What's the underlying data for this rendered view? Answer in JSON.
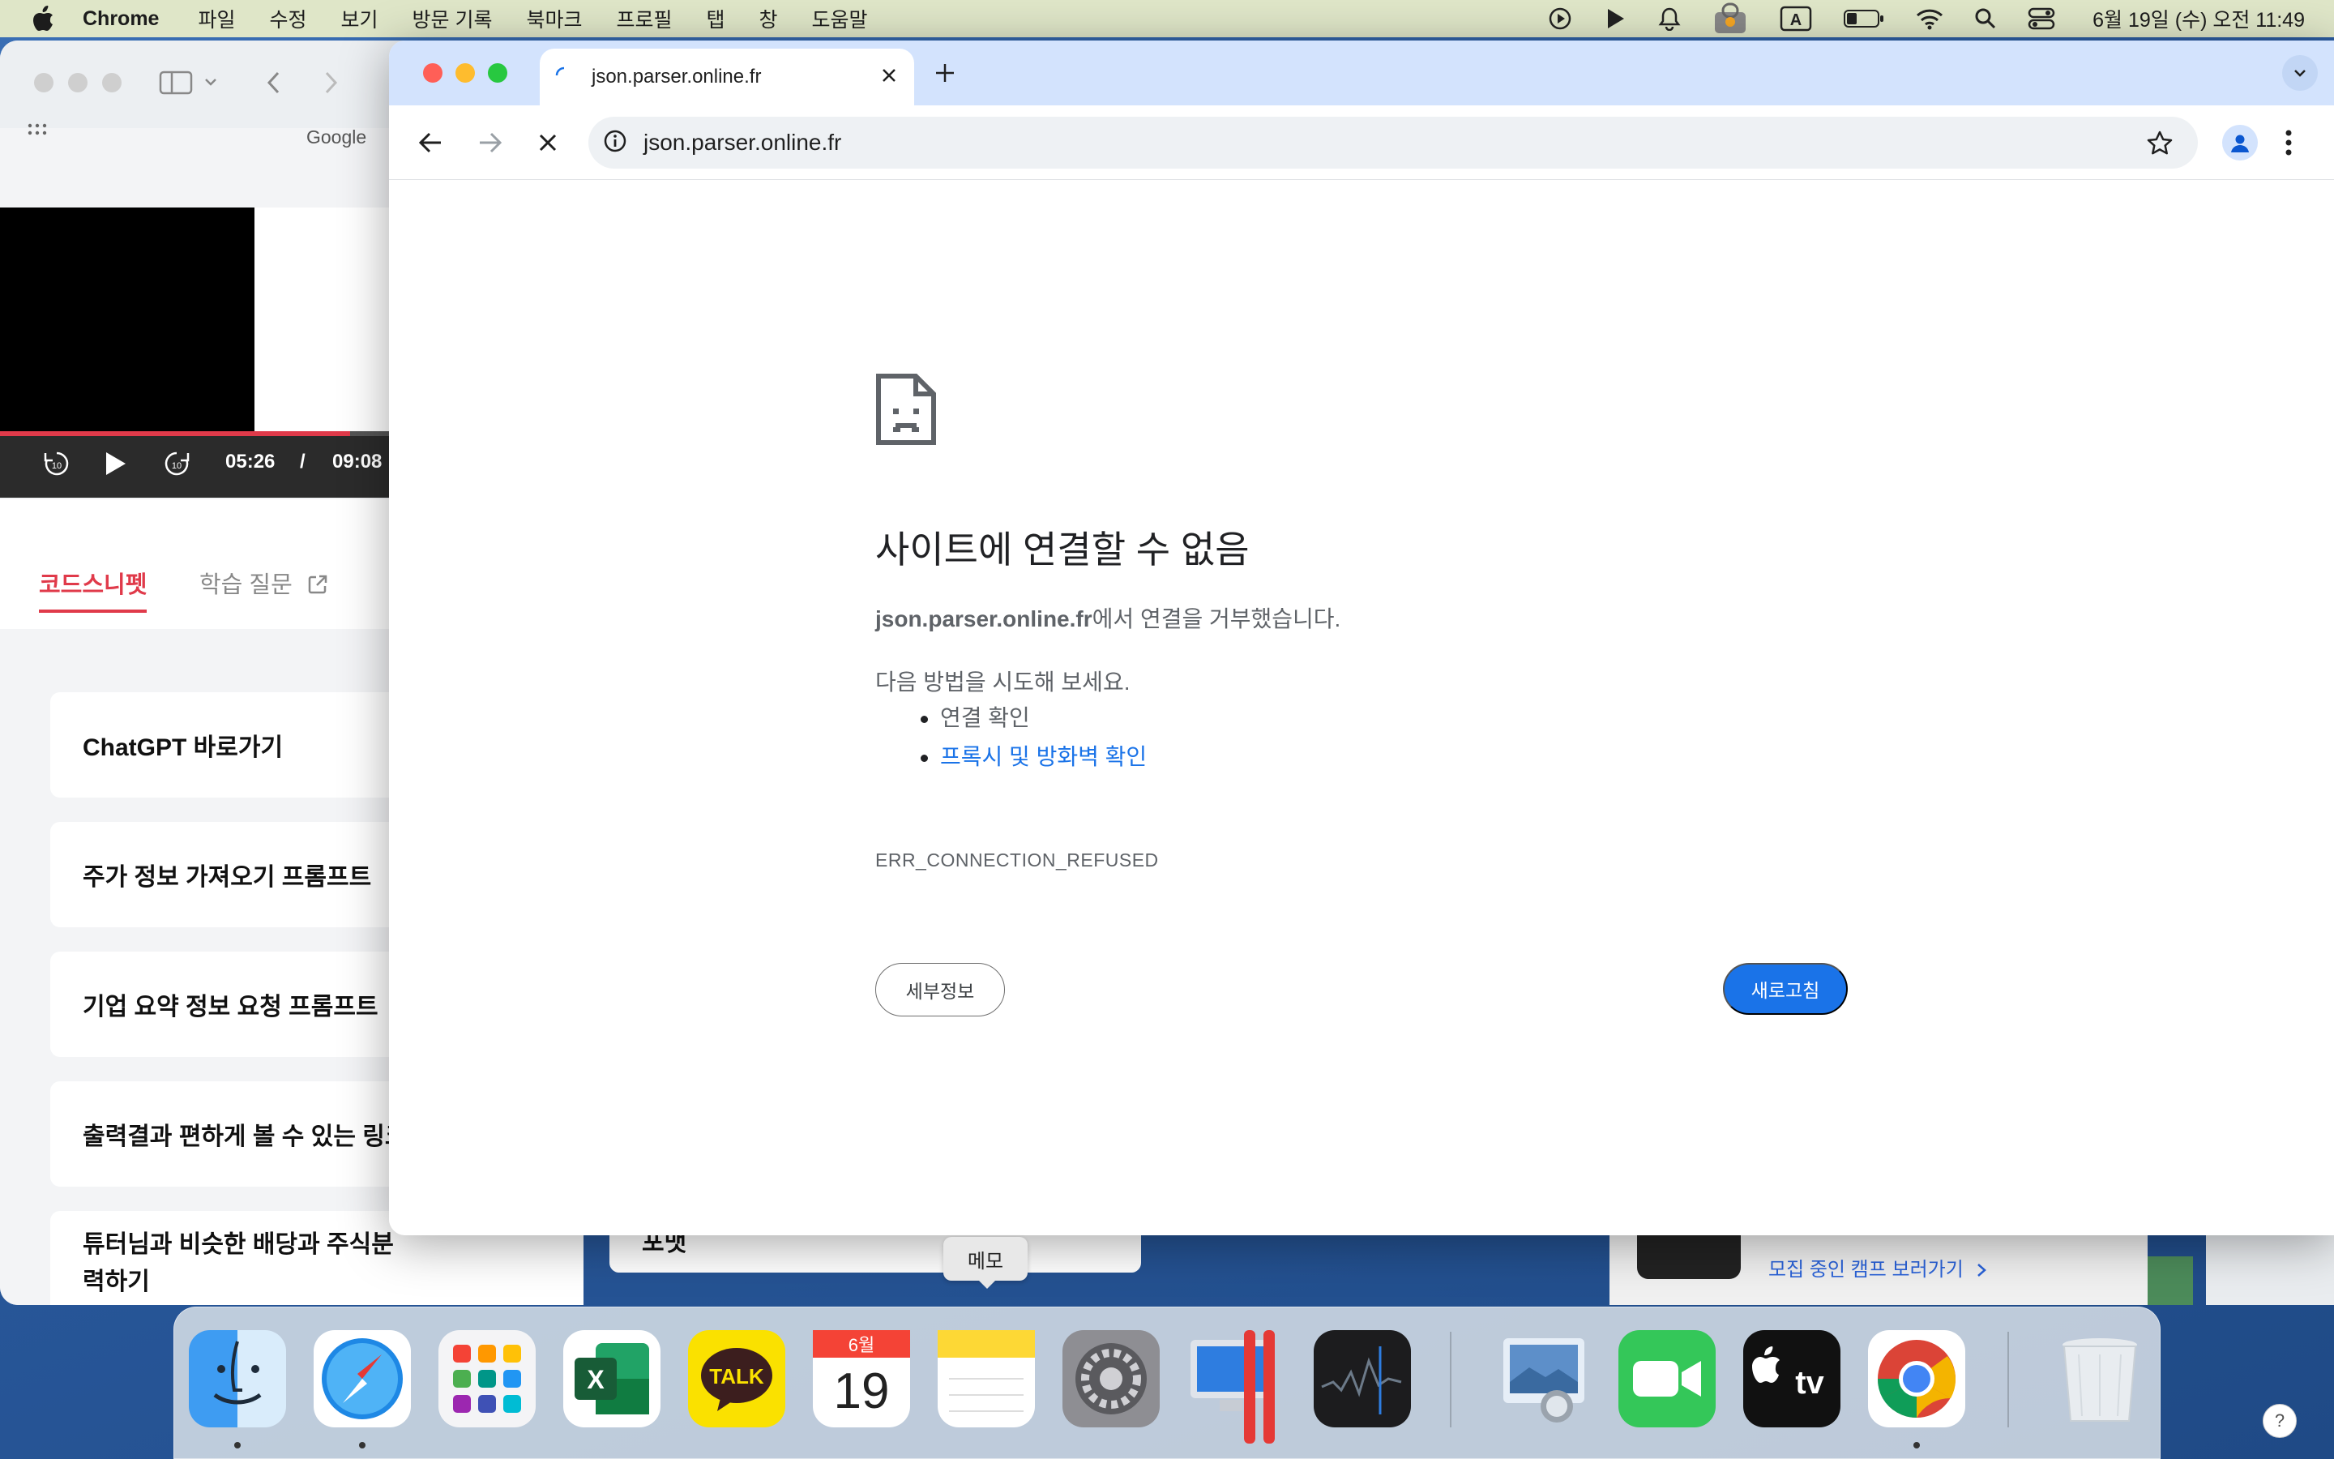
{
  "menubar": {
    "app_name": "Chrome",
    "items": [
      "파일",
      "수정",
      "보기",
      "방문 기록",
      "북마크",
      "프로필",
      "탭",
      "창",
      "도움말"
    ],
    "input_indicator": "A",
    "clock": "6월 19일 (수) 오전 11:49"
  },
  "background_window": {
    "bookmark_label": "Google",
    "video": {
      "current_time": "05:26",
      "separator": "/",
      "duration": "09:08",
      "progress_fraction": 0.6
    },
    "tabs": [
      {
        "label": "코드스니펫"
      },
      {
        "label": "학습 질문"
      }
    ],
    "cards": [
      "ChatGPT 바로가기",
      "주가 정보 가져오기 프롬프트",
      "기업 요약 정보 요청 프롬프트",
      "출력결과 편하게 볼 수 있는 링크",
      "튜터님과 비슷한 배당과 주식분",
      "력하기"
    ],
    "peek_card_text": "포맷",
    "peek_cta": "모집 중인 캠프 보러가기"
  },
  "chrome": {
    "tab_title": "json.parser.online.fr",
    "address": "json.parser.online.fr",
    "error": {
      "title": "사이트에 연결할 수 없음",
      "host": "json.parser.online.fr",
      "desc_suffix": "에서 연결을 거부했습니다.",
      "try_heading": "다음 방법을 시도해 보세요.",
      "suggestions": [
        "연결 확인",
        "프록시 및 방화벽 확인"
      ],
      "code": "ERR_CONNECTION_REFUSED",
      "details_label": "세부정보",
      "reload_label": "새로고침"
    }
  },
  "dock": {
    "tooltip": "메모",
    "calendar_month": "6월",
    "calendar_day": "19",
    "kakao_label": "TALK",
    "excel_label": "X",
    "tv_label": "tv",
    "help": "?"
  }
}
